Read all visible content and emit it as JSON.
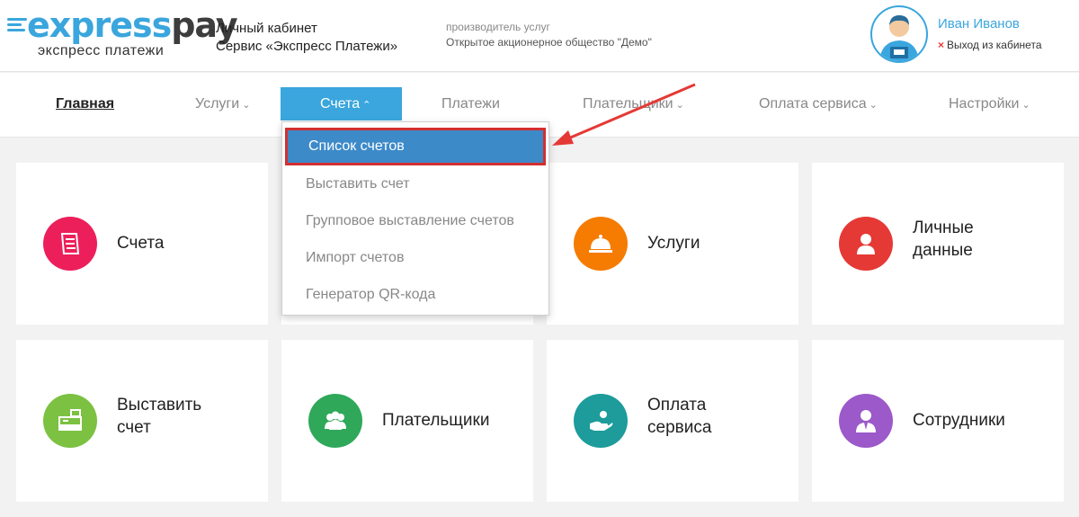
{
  "header": {
    "logo_part1": "express",
    "logo_part2": "pay",
    "logo_subtitle": "экспресс платежи",
    "cabinet_line1": "Личный кабинет",
    "cabinet_line2": "Сервис «Экспресс Платежи»",
    "provider_label": "производитель услуг",
    "provider_name": "Открытое акционерное общество \"Демо\"",
    "user_name": "Иван Иванов",
    "logout_icon": "×",
    "logout_label": "Выход из кабинета"
  },
  "nav": {
    "home": "Главная",
    "services": "Услуги",
    "invoices": "Счета",
    "payments": "Платежи",
    "payers": "Плательщики",
    "service_payment": "Оплата сервиса",
    "settings": "Настройки",
    "chevron_down": "⌄",
    "chevron_up": "⌃"
  },
  "dropdown": {
    "items": [
      "Список счетов",
      "Выставить счет",
      "Групповое выставление счетов",
      "Импорт счетов",
      "Генератор QR-кода"
    ]
  },
  "cards": {
    "invoices": "Счета",
    "services": "Услуги",
    "personal_line1": "Личные",
    "personal_line2": "данные",
    "issue_line1": "Выставить",
    "issue_line2": "счет",
    "payers": "Плательщики",
    "service_pay_line1": "Оплата",
    "service_pay_line2": "сервиса",
    "employees": "Сотрудники"
  },
  "colors": {
    "accent": "#3aa6dd",
    "dropdown_selected": "#3d8ac9",
    "highlight_border": "#d32f2f",
    "icon_invoices": "#ec1f5a",
    "icon_services": "#f57c00",
    "icon_personal": "#e53935",
    "icon_issue": "#7cc142",
    "icon_payers": "#2fa85a",
    "icon_service_pay": "#1e9b9b",
    "icon_employees": "#9b59c9"
  }
}
